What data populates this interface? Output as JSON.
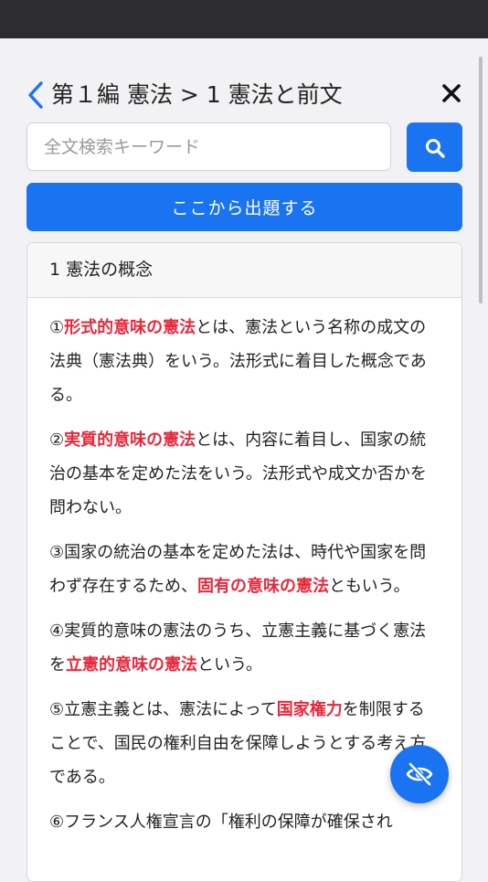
{
  "header": {
    "breadcrumb": "第１編 憲法 > 1 憲法と前文"
  },
  "search": {
    "placeholder": "全文検索キーワード",
    "value": ""
  },
  "start_button": {
    "label": "ここから出題する"
  },
  "section": {
    "title": "1 憲法の概念",
    "paragraphs": [
      [
        "①",
        {
          "hl": "形式的意味の憲法"
        },
        "とは、憲法という名称の成文の法典（憲法典）をいう。法形式に着目した概念である。"
      ],
      [
        "②",
        {
          "hl": "実質的意味の憲法"
        },
        "とは、内容に着目し、国家の統治の基本を定めた法をいう。法形式や成文か否かを問わない。"
      ],
      [
        "③国家の統治の基本を定めた法は、時代や国家を問わず存在するため、",
        {
          "hl": "固有の意味の憲法"
        },
        "ともいう。"
      ],
      [
        "④実質的意味の憲法のうち、立憲主義に基づく憲法を",
        {
          "hl": "立憲的意味の憲法"
        },
        "という。"
      ],
      [
        "⑤立憲主義とは、憲法によって",
        {
          "hl": "国家権力"
        },
        "を制限することで、国民の権利自由を保障しようとする考え方である。"
      ],
      [
        "⑥フランス人権宣言の「権利の保障が確保され"
      ]
    ]
  },
  "icons": {
    "back": "chevron-left-icon",
    "close": "close-icon",
    "search": "search-icon",
    "fab": "eye-slash-icon"
  },
  "colors": {
    "accent": "#1a73f0",
    "highlight": "#e8283a"
  }
}
